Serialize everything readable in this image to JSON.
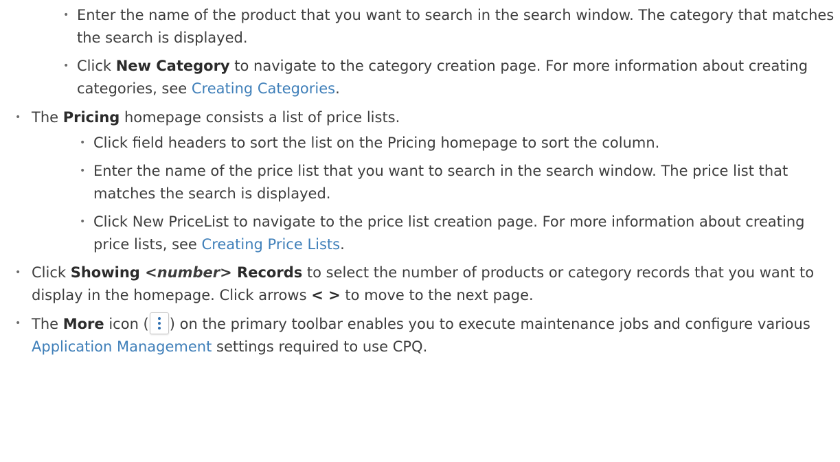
{
  "category_items": {
    "search": "Enter the name of the product that you want to search in the search window. The category that matches the search is displayed.",
    "new_category_pre": "Click ",
    "new_category_bold": "New Category",
    "new_category_mid": " to navigate to the category creation page. For more information about creating categories, see ",
    "new_category_link": "Creating Categories",
    "new_category_post": "."
  },
  "pricing": {
    "intro_pre": "The ",
    "intro_bold": "Pricing",
    "intro_post": " homepage consists a list of price lists.",
    "sub": {
      "sort": "Click field headers to sort the list on the Pricing homepage to sort the column.",
      "search": "Enter the name of the price list that you want to search in the search window. The price list that matches the search is displayed.",
      "new_pre": "Click New PriceList to navigate to the price list creation page. For more information about creating price lists, see ",
      "new_link": "Creating Price Lists",
      "new_post": "."
    }
  },
  "showing": {
    "pre": "Click ",
    "bold1": "Showing ",
    "ital": "<number>",
    "bold2": " Records",
    "post": " to select the number of products or category records that you want to display in the homepage. Click arrows ",
    "arrows": "< >",
    "tail": " to move to the next page."
  },
  "more": {
    "pre": "The ",
    "bold": "More",
    "mid1": " icon (",
    "icon": "more-vertical-icon",
    "mid2": ") on the primary toolbar enables you to execute maintenance jobs and configure various ",
    "link": "Application Management",
    "post": " settings required to use CPQ."
  },
  "colors": {
    "text": "#3d3d3d",
    "link": "#3f7fb9",
    "icon_dots": "#2f6fb0"
  }
}
